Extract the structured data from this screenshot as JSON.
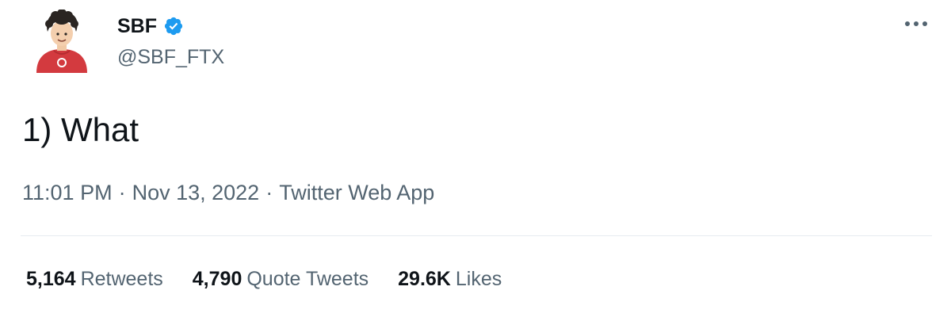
{
  "colors": {
    "text_primary": "#0f1419",
    "text_secondary": "#536471",
    "verified_blue": "#1d9bf0",
    "divider": "#e6ecf0",
    "avatar_shirt": "#d33a3f"
  },
  "author": {
    "display_name": "SBF",
    "handle": "@SBF_FTX",
    "verified": true,
    "avatar_icon": "cartoon-avatar"
  },
  "tweet": {
    "text": "1) What",
    "time": "11:01 PM",
    "separator": "·",
    "date": "Nov 13, 2022",
    "source": "Twitter Web App"
  },
  "menu": {
    "icon": "more-options-icon"
  },
  "stats": {
    "retweets": {
      "count": "5,164",
      "label": "Retweets"
    },
    "quotes": {
      "count": "4,790",
      "label": "Quote Tweets"
    },
    "likes": {
      "count": "29.6K",
      "label": "Likes"
    }
  }
}
